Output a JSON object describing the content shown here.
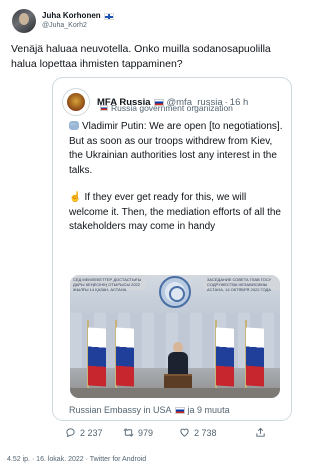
{
  "author": {
    "display_name": "Juha Korhonen",
    "handle": "@Juha_Korh2",
    "flag_icon": "finland-flag-icon"
  },
  "tweet_text": "Venäjä haluaa neuvotella. Onko muilla sodanosapuolilla halua lopettaa ihmisten tappaminen?",
  "quoted": {
    "display_name": "MFA Russia",
    "handle": "@mfa_russia",
    "separator": "·",
    "time": "16 h",
    "label": "Russia government organization",
    "paragraph1": "Vladimir Putin: We are open [to negotiations]. But as soon as our troops withdrew from Kiev, the Ukrainian authorities lost any interest in the talks.",
    "paragraph2": "If they ever get ready for this, we will welcome it. Then, the mediation efforts of all the stakeholders may come in handy",
    "image": {
      "banner_left": "СЕД МЕМЛЕКЕТТЕР ДОСТАСТЫҒЫ ДАРЫ КЕҢЕСІНІҢ ОТЫРЫСЫ 2022 ЖЫЛҒЫ 14 ҚАЗАН, АСТАНА",
      "banner_right": "ЗАСЕДАНИЕ СОВЕТА ГЛАВ ГОСУ СОДРУЖЕСТВА НЕЗАВИСИМЫ АСТАНА, 14 ОКТЯБРЯ 2022 ГОДА"
    },
    "tagged": "Russian Embassy in USA",
    "tagged_more": "ja 9 muuta"
  },
  "actions": {
    "replies": "2 237",
    "retweets": "979",
    "likes": "2 738"
  },
  "footer": "4.52 ip. · 16. lokak. 2022 · Twitter for Android",
  "colors": {
    "text": "#0f1419",
    "muted": "#536471",
    "border": "#cfd9de"
  }
}
